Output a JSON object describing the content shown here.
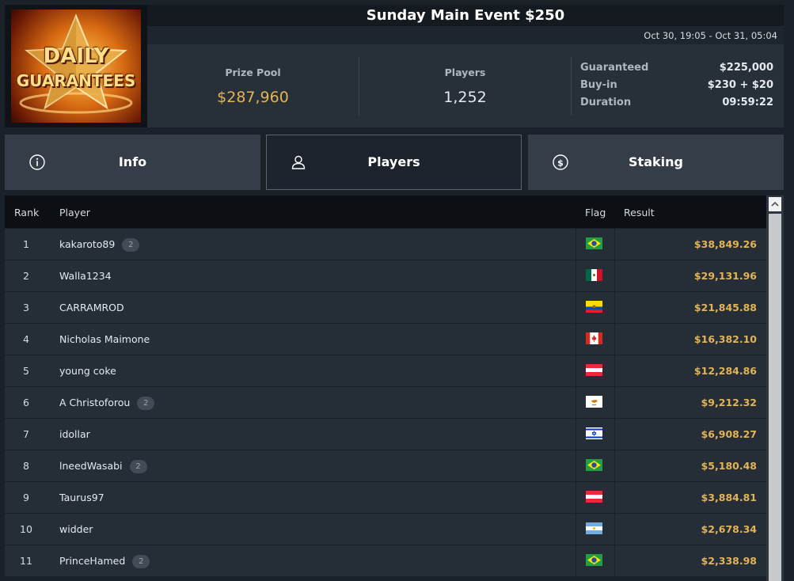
{
  "logo": {
    "line1": "DAILY",
    "line2": "GUARANTEES"
  },
  "header": {
    "title": "Sunday Main Event $250",
    "dates": "Oct 30, 19:05 - Oct 31, 05:04"
  },
  "stats": {
    "prize_pool_label": "Prize Pool",
    "prize_pool_value": "$287,960",
    "players_label": "Players",
    "players_value": "1,252",
    "details": [
      {
        "label": "Guaranteed",
        "value": "$225,000"
      },
      {
        "label": "Buy-in",
        "value": "$230 + $20"
      },
      {
        "label": "Duration",
        "value": "09:59:22"
      }
    ]
  },
  "tabs": {
    "info": {
      "label": "Info",
      "icon": "info-icon"
    },
    "players": {
      "label": "Players",
      "icon": "user-icon",
      "active": true
    },
    "staking": {
      "label": "Staking",
      "icon": "dollar-coin-icon"
    }
  },
  "table": {
    "columns": {
      "rank": "Rank",
      "player": "Player",
      "flag": "Flag",
      "result": "Result"
    },
    "rows": [
      {
        "rank": "1",
        "player": "kakaroto89",
        "badge": "2",
        "flag": "brazil",
        "result": "$38,849.26"
      },
      {
        "rank": "2",
        "player": "Walla1234",
        "badge": "",
        "flag": "mexico",
        "result": "$29,131.96"
      },
      {
        "rank": "3",
        "player": "CARRAMROD",
        "badge": "",
        "flag": "ecuador",
        "result": "$21,845.88"
      },
      {
        "rank": "4",
        "player": "Nicholas Maimone",
        "badge": "",
        "flag": "canada",
        "result": "$16,382.10"
      },
      {
        "rank": "5",
        "player": "young coke",
        "badge": "",
        "flag": "austria",
        "result": "$12,284.86"
      },
      {
        "rank": "6",
        "player": "A Christoforou",
        "badge": "2",
        "flag": "cyprus",
        "result": "$9,212.32"
      },
      {
        "rank": "7",
        "player": "idollar",
        "badge": "",
        "flag": "israel",
        "result": "$6,908.27"
      },
      {
        "rank": "8",
        "player": "lneedWasabi",
        "badge": "2",
        "flag": "brazil",
        "result": "$5,180.48"
      },
      {
        "rank": "9",
        "player": "Taurus97",
        "badge": "",
        "flag": "austria",
        "result": "$3,884.81"
      },
      {
        "rank": "10",
        "player": "widder",
        "badge": "",
        "flag": "argentina",
        "result": "$2,678.34"
      },
      {
        "rank": "11",
        "player": "PrinceHamed",
        "badge": "2",
        "flag": "brazil",
        "result": "$2,338.98"
      }
    ]
  },
  "colors": {
    "accent_gold": "#e2b455",
    "row_bg": "#252d37",
    "header_bg": "#0c0f13"
  }
}
